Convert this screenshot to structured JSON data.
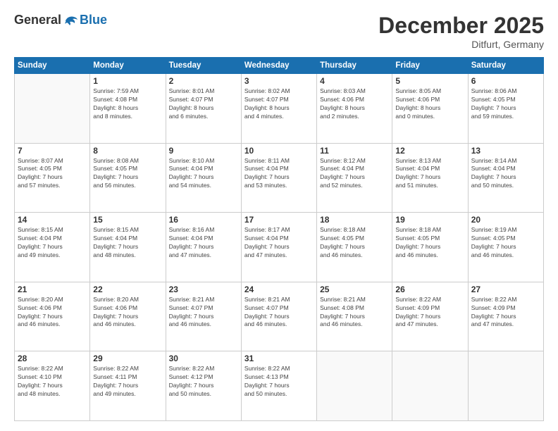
{
  "header": {
    "logo_general": "General",
    "logo_blue": "Blue",
    "month_title": "December 2025",
    "subtitle": "Ditfurt, Germany"
  },
  "days_of_week": [
    "Sunday",
    "Monday",
    "Tuesday",
    "Wednesday",
    "Thursday",
    "Friday",
    "Saturday"
  ],
  "weeks": [
    [
      {
        "num": "",
        "info": ""
      },
      {
        "num": "1",
        "info": "Sunrise: 7:59 AM\nSunset: 4:08 PM\nDaylight: 8 hours\nand 8 minutes."
      },
      {
        "num": "2",
        "info": "Sunrise: 8:01 AM\nSunset: 4:07 PM\nDaylight: 8 hours\nand 6 minutes."
      },
      {
        "num": "3",
        "info": "Sunrise: 8:02 AM\nSunset: 4:07 PM\nDaylight: 8 hours\nand 4 minutes."
      },
      {
        "num": "4",
        "info": "Sunrise: 8:03 AM\nSunset: 4:06 PM\nDaylight: 8 hours\nand 2 minutes."
      },
      {
        "num": "5",
        "info": "Sunrise: 8:05 AM\nSunset: 4:06 PM\nDaylight: 8 hours\nand 0 minutes."
      },
      {
        "num": "6",
        "info": "Sunrise: 8:06 AM\nSunset: 4:05 PM\nDaylight: 7 hours\nand 59 minutes."
      }
    ],
    [
      {
        "num": "7",
        "info": "Sunrise: 8:07 AM\nSunset: 4:05 PM\nDaylight: 7 hours\nand 57 minutes."
      },
      {
        "num": "8",
        "info": "Sunrise: 8:08 AM\nSunset: 4:05 PM\nDaylight: 7 hours\nand 56 minutes."
      },
      {
        "num": "9",
        "info": "Sunrise: 8:10 AM\nSunset: 4:04 PM\nDaylight: 7 hours\nand 54 minutes."
      },
      {
        "num": "10",
        "info": "Sunrise: 8:11 AM\nSunset: 4:04 PM\nDaylight: 7 hours\nand 53 minutes."
      },
      {
        "num": "11",
        "info": "Sunrise: 8:12 AM\nSunset: 4:04 PM\nDaylight: 7 hours\nand 52 minutes."
      },
      {
        "num": "12",
        "info": "Sunrise: 8:13 AM\nSunset: 4:04 PM\nDaylight: 7 hours\nand 51 minutes."
      },
      {
        "num": "13",
        "info": "Sunrise: 8:14 AM\nSunset: 4:04 PM\nDaylight: 7 hours\nand 50 minutes."
      }
    ],
    [
      {
        "num": "14",
        "info": "Sunrise: 8:15 AM\nSunset: 4:04 PM\nDaylight: 7 hours\nand 49 minutes."
      },
      {
        "num": "15",
        "info": "Sunrise: 8:15 AM\nSunset: 4:04 PM\nDaylight: 7 hours\nand 48 minutes."
      },
      {
        "num": "16",
        "info": "Sunrise: 8:16 AM\nSunset: 4:04 PM\nDaylight: 7 hours\nand 47 minutes."
      },
      {
        "num": "17",
        "info": "Sunrise: 8:17 AM\nSunset: 4:04 PM\nDaylight: 7 hours\nand 47 minutes."
      },
      {
        "num": "18",
        "info": "Sunrise: 8:18 AM\nSunset: 4:05 PM\nDaylight: 7 hours\nand 46 minutes."
      },
      {
        "num": "19",
        "info": "Sunrise: 8:18 AM\nSunset: 4:05 PM\nDaylight: 7 hours\nand 46 minutes."
      },
      {
        "num": "20",
        "info": "Sunrise: 8:19 AM\nSunset: 4:05 PM\nDaylight: 7 hours\nand 46 minutes."
      }
    ],
    [
      {
        "num": "21",
        "info": "Sunrise: 8:20 AM\nSunset: 4:06 PM\nDaylight: 7 hours\nand 46 minutes."
      },
      {
        "num": "22",
        "info": "Sunrise: 8:20 AM\nSunset: 4:06 PM\nDaylight: 7 hours\nand 46 minutes."
      },
      {
        "num": "23",
        "info": "Sunrise: 8:21 AM\nSunset: 4:07 PM\nDaylight: 7 hours\nand 46 minutes."
      },
      {
        "num": "24",
        "info": "Sunrise: 8:21 AM\nSunset: 4:07 PM\nDaylight: 7 hours\nand 46 minutes."
      },
      {
        "num": "25",
        "info": "Sunrise: 8:21 AM\nSunset: 4:08 PM\nDaylight: 7 hours\nand 46 minutes."
      },
      {
        "num": "26",
        "info": "Sunrise: 8:22 AM\nSunset: 4:09 PM\nDaylight: 7 hours\nand 47 minutes."
      },
      {
        "num": "27",
        "info": "Sunrise: 8:22 AM\nSunset: 4:09 PM\nDaylight: 7 hours\nand 47 minutes."
      }
    ],
    [
      {
        "num": "28",
        "info": "Sunrise: 8:22 AM\nSunset: 4:10 PM\nDaylight: 7 hours\nand 48 minutes."
      },
      {
        "num": "29",
        "info": "Sunrise: 8:22 AM\nSunset: 4:11 PM\nDaylight: 7 hours\nand 49 minutes."
      },
      {
        "num": "30",
        "info": "Sunrise: 8:22 AM\nSunset: 4:12 PM\nDaylight: 7 hours\nand 50 minutes."
      },
      {
        "num": "31",
        "info": "Sunrise: 8:22 AM\nSunset: 4:13 PM\nDaylight: 7 hours\nand 50 minutes."
      },
      {
        "num": "",
        "info": ""
      },
      {
        "num": "",
        "info": ""
      },
      {
        "num": "",
        "info": ""
      }
    ]
  ]
}
